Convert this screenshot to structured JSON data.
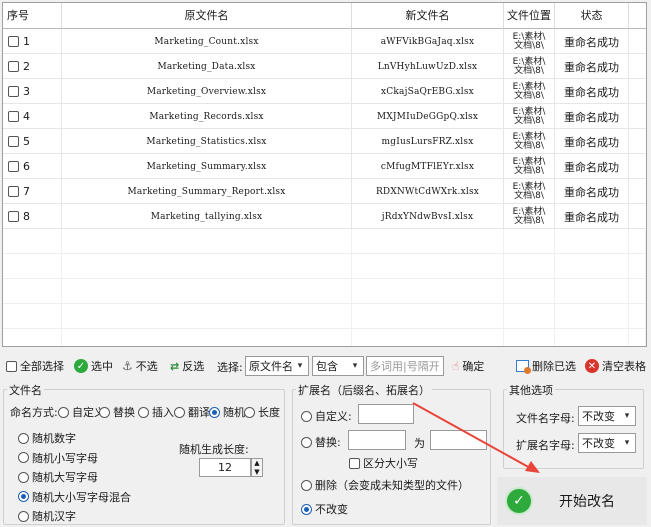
{
  "table": {
    "headers": [
      "序号",
      "原文件名",
      "新文件名",
      "文件位置",
      "状态"
    ],
    "rows": [
      {
        "n": "1",
        "orig": "Marketing_Count.xlsx",
        "new": "aWFVikBGaJaq.xlsx",
        "loc1": "E:\\素材\\",
        "loc2": "文档\\8\\",
        "status": "重命名成功"
      },
      {
        "n": "2",
        "orig": "Marketing_Data.xlsx",
        "new": "LnVHyhLuwUzD.xlsx",
        "loc1": "E:\\素材\\",
        "loc2": "文档\\8\\",
        "status": "重命名成功"
      },
      {
        "n": "3",
        "orig": "Marketing_Overview.xlsx",
        "new": "xCkajSaQrEBG.xlsx",
        "loc1": "E:\\素材\\",
        "loc2": "文档\\8\\",
        "status": "重命名成功"
      },
      {
        "n": "4",
        "orig": "Marketing_Records.xlsx",
        "new": "MXJMIuDeGGpQ.xlsx",
        "loc1": "E:\\素材\\",
        "loc2": "文档\\8\\",
        "status": "重命名成功"
      },
      {
        "n": "5",
        "orig": "Marketing_Statistics.xlsx",
        "new": "mgIusLursFRZ.xlsx",
        "loc1": "E:\\素材\\",
        "loc2": "文档\\8\\",
        "status": "重命名成功"
      },
      {
        "n": "6",
        "orig": "Marketing_Summary.xlsx",
        "new": "cMfugMTFlEYr.xlsx",
        "loc1": "E:\\素材\\",
        "loc2": "文档\\8\\",
        "status": "重命名成功"
      },
      {
        "n": "7",
        "orig": "Marketing_Summary_Report.xlsx",
        "new": "RDXNWtCdWXrk.xlsx",
        "loc1": "E:\\素材\\",
        "loc2": "文档\\8\\",
        "status": "重命名成功"
      },
      {
        "n": "8",
        "orig": "Marketing_tallying.xlsx",
        "new": "jRdxYNdwBvsI.xlsx",
        "loc1": "E:\\素材\\",
        "loc2": "文档\\8\\",
        "status": "重命名成功"
      }
    ]
  },
  "toolbar": {
    "select_all": "全部选择",
    "select": "选中",
    "deselect": "不选",
    "invert": "反选",
    "choose_label": "选择:",
    "field_value": "原文件名",
    "match_value": "包含",
    "keyword_placeholder": "多词用|号隔开",
    "confirm": "确定",
    "delete_selected": "删除已选",
    "clear_table": "清空表格"
  },
  "filename_panel": {
    "title": "文件名",
    "mode_label": "命名方式:",
    "modes": [
      "自定义",
      "替换",
      "插入",
      "翻译",
      "随机",
      "长度"
    ],
    "mode_selected": "随机",
    "random_types": [
      "随机数字",
      "随机小写字母",
      "随机大写字母",
      "随机大小写字母混合",
      "随机汉字"
    ],
    "random_selected": "随机大小写字母混合",
    "length_label": "随机生成长度:",
    "length_value": "12"
  },
  "ext_panel": {
    "title": "扩展名（后缀名、拓展名）",
    "custom": "自定义:",
    "replace": "替换:",
    "to": "为",
    "case_sensitive": "区分大小写",
    "delete": "删除（会变成未知类型的文件）",
    "no_change": "不改变",
    "selected": "不改变"
  },
  "other_panel": {
    "title": "其他选项",
    "filename_case_label": "文件名字母:",
    "filename_case_value": "不改变",
    "ext_case_label": "扩展名字母:",
    "ext_case_value": "不改变"
  },
  "start_button": "开始改名",
  "colors": {
    "accent": "#1a5fb4",
    "ok_green": "#2eaa3c",
    "red": "#d9342b",
    "arrow": "#e8443a"
  }
}
